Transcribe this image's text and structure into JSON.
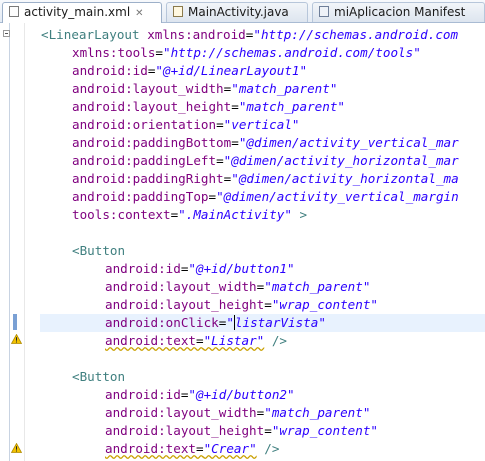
{
  "tabs": [
    {
      "label": "activity_main.xml",
      "close": "✕",
      "icon": "xml-file-icon",
      "active": true
    },
    {
      "label": "MainActivity.java",
      "icon": "java-file-icon",
      "active": false
    },
    {
      "label": "miAplicacion Manifest",
      "icon": "manifest-file-icon",
      "active": false
    }
  ],
  "code": {
    "l1": {
      "lt": "<",
      "tag": "LinearLayout",
      "attr": "xmlns:android",
      "eq": "=",
      "val": "\"http://schemas.android.com"
    },
    "l2": {
      "attr": "xmlns:tools",
      "eq": "=",
      "val": "\"http://schemas.android.com/tools\""
    },
    "l3": {
      "attr": "android:id",
      "eq": "=",
      "val": "\"@+id/LinearLayout1\""
    },
    "l4": {
      "attr": "android:layout_width",
      "eq": "=",
      "val": "\"match_parent\""
    },
    "l5": {
      "attr": "android:layout_height",
      "eq": "=",
      "val": "\"match_parent\""
    },
    "l6": {
      "attr": "android:orientation",
      "eq": "=",
      "val": "\"vertical\""
    },
    "l7": {
      "attr": "android:paddingBottom",
      "eq": "=",
      "val": "\"@dimen/activity_vertical_mar"
    },
    "l8": {
      "attr": "android:paddingLeft",
      "eq": "=",
      "val": "\"@dimen/activity_horizontal_mar"
    },
    "l9": {
      "attr": "android:paddingRight",
      "eq": "=",
      "val": "\"@dimen/activity_horizontal_ma"
    },
    "l10": {
      "attr": "android:paddingTop",
      "eq": "=",
      "val": "\"@dimen/activity_vertical_margin"
    },
    "l11": {
      "attr": "tools:context",
      "eq": "=",
      "val": "\".MainActivity\"",
      "end": " >"
    },
    "l13": {
      "lt": "<",
      "tag": "Button"
    },
    "l14": {
      "attr": "android:id",
      "eq": "=",
      "val": "\"@+id/button1\""
    },
    "l15": {
      "attr": "android:layout_width",
      "eq": "=",
      "val": "\"match_parent\""
    },
    "l16": {
      "attr": "android:layout_height",
      "eq": "=",
      "val": "\"wrap_content\""
    },
    "l17": {
      "attr": "android:onClick",
      "eq": "=",
      "val_a": "\"",
      "val_b": "listarVista\""
    },
    "l18": {
      "attr": "android:text",
      "eq": "=",
      "val": "\"Listar\"",
      "end": " />"
    },
    "l20": {
      "lt": "<",
      "tag": "Button"
    },
    "l21": {
      "attr": "android:id",
      "eq": "=",
      "val": "\"@+id/button2\""
    },
    "l22": {
      "attr": "android:layout_width",
      "eq": "=",
      "val": "\"match_parent\""
    },
    "l23": {
      "attr": "android:layout_height",
      "eq": "=",
      "val": "\"wrap_content\""
    },
    "l24": {
      "attr": "android:text",
      "eq": "=",
      "val": "\"Crear\"",
      "end": " />"
    }
  },
  "colors": {
    "tag": "#3f7f7f",
    "attribute": "#7f007f",
    "value": "#2a00ff",
    "current_line": "#e8f2fe",
    "warning": "#e6b800"
  },
  "gutter_icons": [
    "collapse-icon",
    "bookmark-icon",
    "warning-icon"
  ]
}
